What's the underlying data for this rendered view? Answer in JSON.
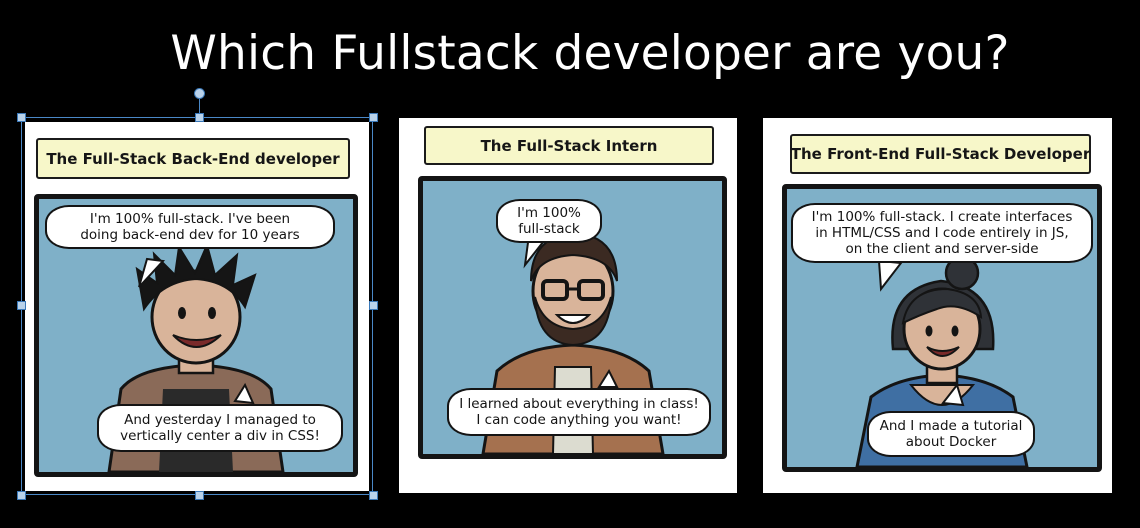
{
  "slide": {
    "title": "Which Fullstack developer are you?"
  },
  "panels": [
    {
      "title": "The Full-Stack Back-End developer",
      "bubble_top": [
        "I'm 100% full-stack. I've been",
        "doing back-end dev for 10 years"
      ],
      "bubble_bottom": [
        "And yesterday I managed to",
        "vertically center a div in CSS!"
      ],
      "selected": true
    },
    {
      "title": "The Full-Stack Intern",
      "bubble_top": [
        "I'm 100%",
        "full-stack"
      ],
      "bubble_bottom": [
        "I learned about everything in class!",
        "I can code anything you want!"
      ],
      "selected": false
    },
    {
      "title": "The Front-End Full-Stack Developer",
      "bubble_top": [
        "I'm 100% full-stack. I create interfaces",
        "in HTML/CSS and I code entirely in JS,",
        "on the client and server-side"
      ],
      "bubble_bottom": [
        "And I made a tutorial",
        "about Docker"
      ],
      "selected": false
    }
  ],
  "colors": {
    "background": "#000000",
    "comic_sky": "#7fb0c8",
    "title_box": "#f7f7c9",
    "selection": "#4a88c7"
  },
  "icons": {
    "selection_handles": "square-handle",
    "rotation_handle": "circle-handle"
  }
}
